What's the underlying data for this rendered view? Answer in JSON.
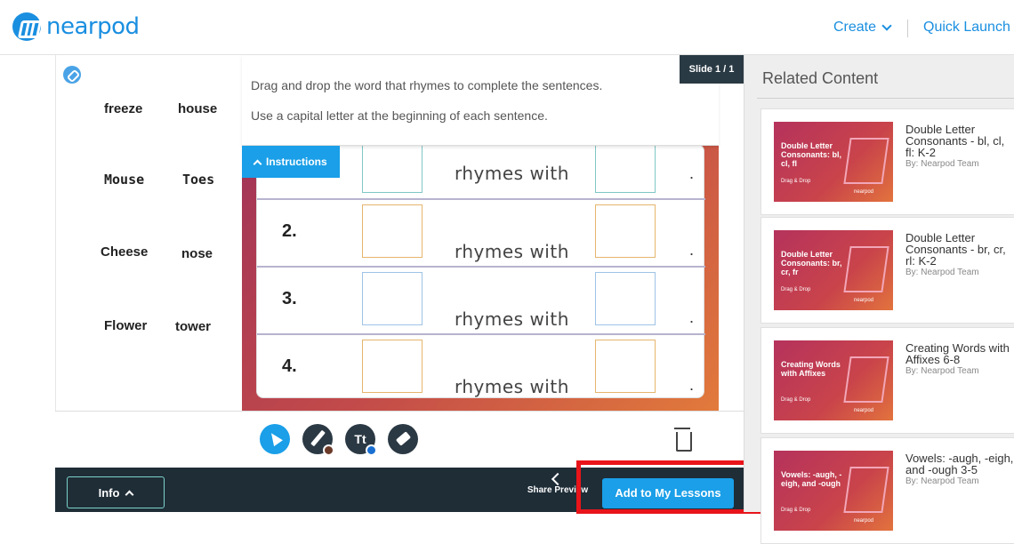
{
  "header": {
    "logo_text": "nearpod",
    "create_label": "Create",
    "quick_launch_label": "Quick Launch"
  },
  "word_bank": [
    {
      "left": "freeze",
      "right": "house"
    },
    {
      "left": "Mouse",
      "right": "Toes"
    },
    {
      "left": "Cheese",
      "right": "nose"
    },
    {
      "left": "Flower",
      "right": "tower"
    }
  ],
  "slide": {
    "badge": "Slide 1 / 1",
    "instructions": [
      "Drag and drop the word that rhymes to complete the sentences.",
      "Use a capital letter at the beginning of each sentence."
    ],
    "instructions_tab": "Instructions",
    "rows": [
      {
        "num": "",
        "text": "rhymes with",
        "end": "."
      },
      {
        "num": "2.",
        "text": "rhymes with",
        "end": "."
      },
      {
        "num": "3.",
        "text": "rhymes with",
        "end": "."
      },
      {
        "num": "4.",
        "text": "rhymes with",
        "end": "."
      }
    ]
  },
  "bottom": {
    "info_label": "Info",
    "share_label": "Share Preview",
    "add_label": "Add to My Lessons"
  },
  "related": {
    "title": "Related Content",
    "items": [
      {
        "thumb_title": "Double Letter Consonants: bl, cl, fl",
        "thumb_sub": "Drag & Drop",
        "title": "Double Letter Consonants - bl, cl, fl: K-2",
        "author": "By: Nearpod Team"
      },
      {
        "thumb_title": "Double Letter Consonants: br, cr, fr",
        "thumb_sub": "Drag & Drop",
        "title": "Double Letter Consonants - br, cr, rl: K-2",
        "author": "By: Nearpod Team"
      },
      {
        "thumb_title": "Creating Words with Affixes",
        "thumb_sub": "Drag & Drop",
        "title": "Creating Words with Affixes 6-8",
        "author": "By: Nearpod Team"
      },
      {
        "thumb_title": "Vowels: -augh, -eigh, and -ough",
        "thumb_sub": "Drag & Drop",
        "title": "Vowels: -augh, -eigh, and -ough 3-5",
        "author": "By: Nearpod Team"
      }
    ],
    "thumb_logo": "nearpod"
  },
  "colors": {
    "brand": "#1a8fe0",
    "accent": "#1a9fe8",
    "highlight": "#e8141a"
  }
}
